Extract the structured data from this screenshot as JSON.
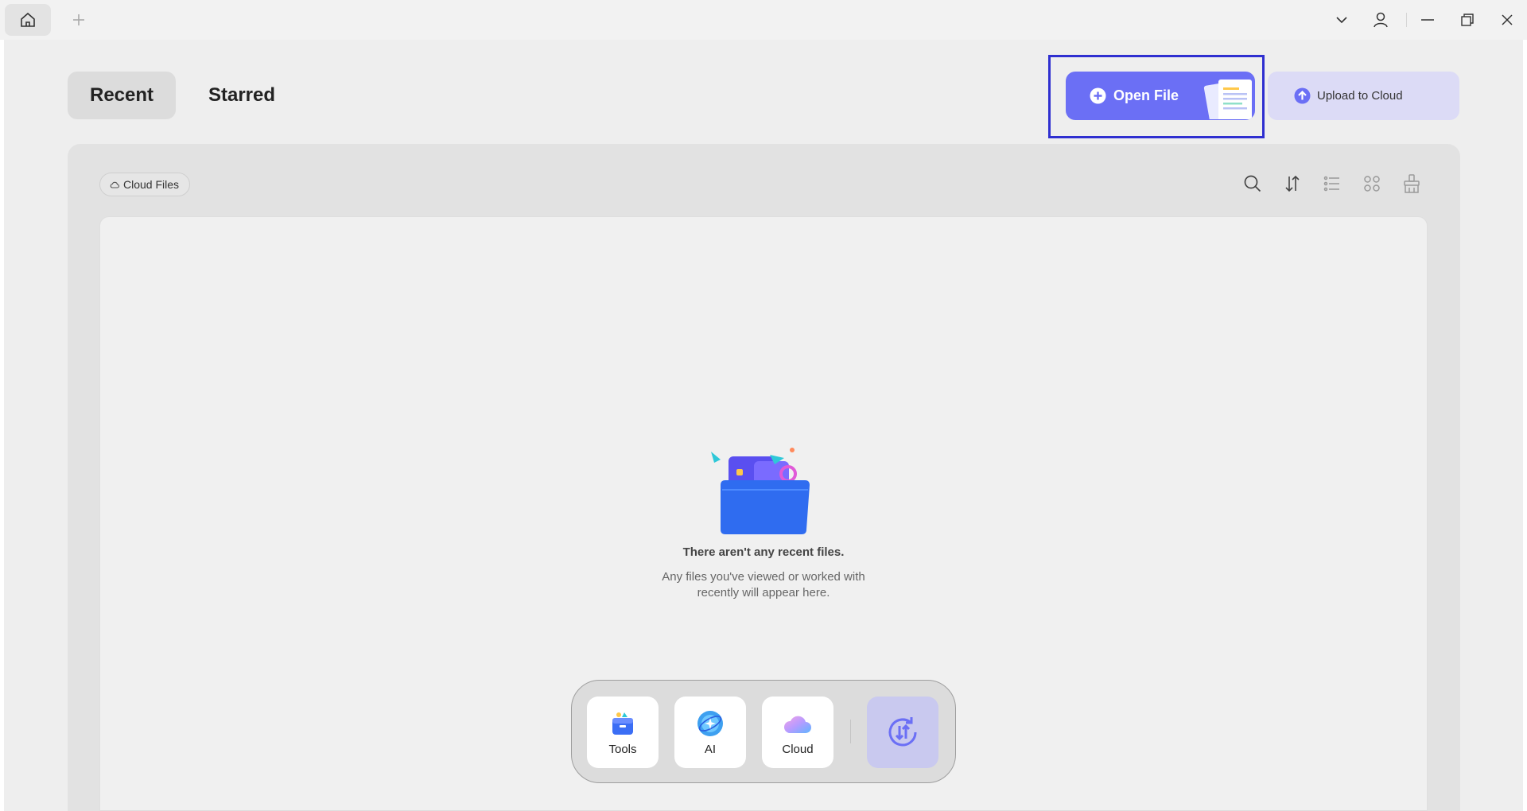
{
  "titlebar": {
    "icons": [
      "home-icon",
      "plus-icon",
      "chevron-down-icon",
      "user-icon",
      "minimize-icon",
      "restore-icon",
      "close-icon"
    ]
  },
  "header": {
    "tabs": [
      {
        "label": "Recent",
        "active": true
      },
      {
        "label": "Starred",
        "active": false
      }
    ],
    "open_file_label": "Open File",
    "upload_label": "Upload to Cloud"
  },
  "toolbar": {
    "cloud_files_label": "Cloud Files",
    "icons": [
      "search-icon",
      "sort-icon",
      "list-view-icon",
      "grid-view-icon",
      "clean-icon"
    ]
  },
  "empty_state": {
    "title": "There aren't any recent files.",
    "description_line1": "Any files you've viewed or worked with",
    "description_line2": "recently will appear here."
  },
  "dock": {
    "items": [
      {
        "label": "Tools",
        "icon": "toolbox-icon"
      },
      {
        "label": "AI",
        "icon": "ai-icon"
      },
      {
        "label": "Cloud",
        "icon": "cloud-icon"
      }
    ],
    "active_icon": "sync-icon"
  },
  "colors": {
    "accent": "#6b6ff5",
    "upload_bg": "#dcdbf6",
    "highlight_border": "#2f2fd0",
    "dock_active": "#c9c9ef"
  }
}
